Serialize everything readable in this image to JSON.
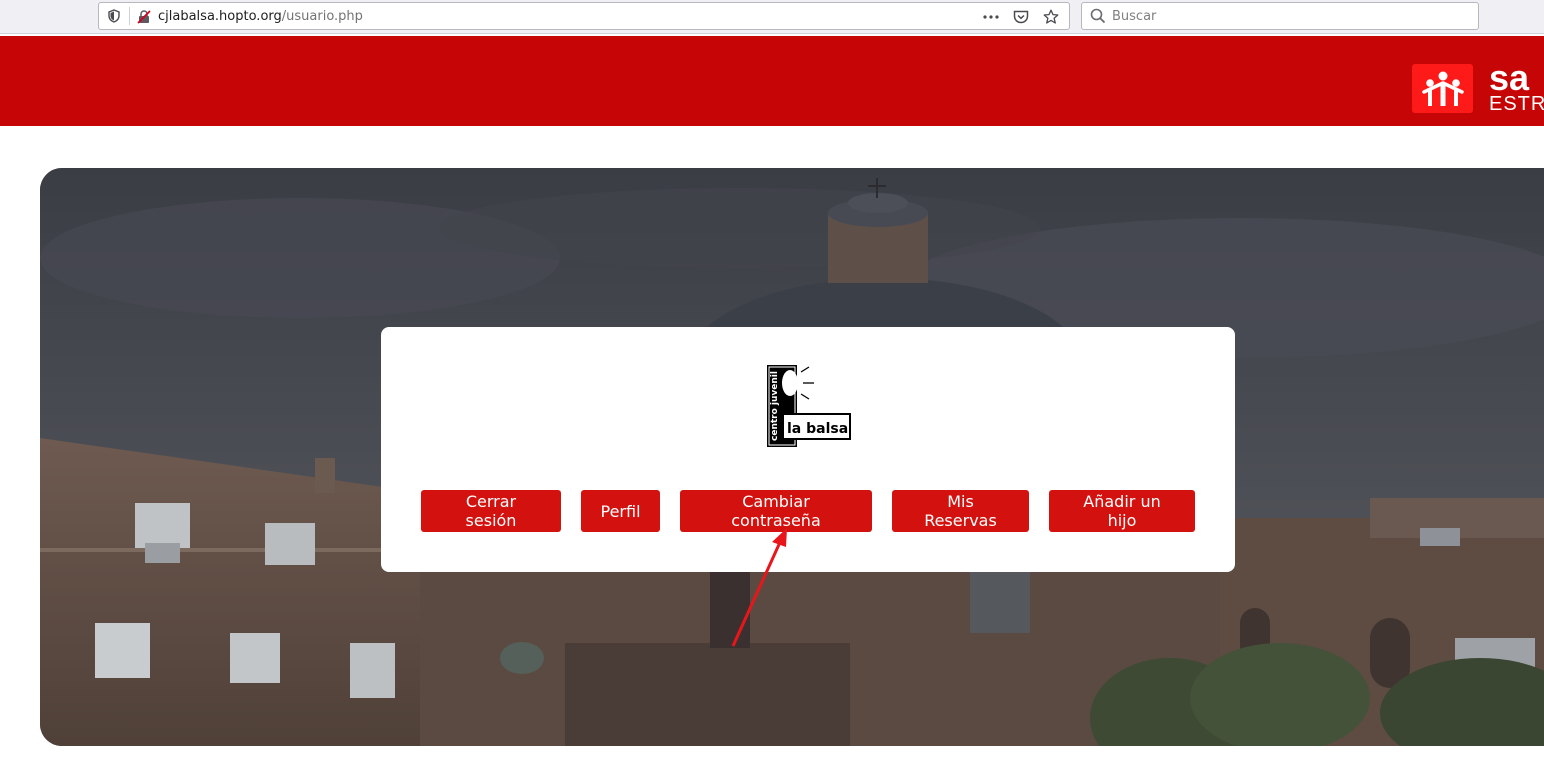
{
  "browser": {
    "url_host": "cjlabalsa.hopto.org",
    "url_path": "/usuario.php",
    "search_placeholder": "Buscar"
  },
  "header": {
    "brand_name": "sa",
    "brand_subtitle": "ESTR"
  },
  "logo": {
    "vertical_text": "centro juvenil",
    "name_text": "la balsa"
  },
  "buttons": {
    "logout": "Cerrar sesión",
    "profile": "Perfil",
    "change_password": "Cambiar contraseña",
    "reservations": "Mis Reservas",
    "add_child": "Añadir un hijo"
  },
  "colors": {
    "header_red": "#c60606",
    "button_red": "#d3120f",
    "annotation_arrow": "#e8161a"
  }
}
